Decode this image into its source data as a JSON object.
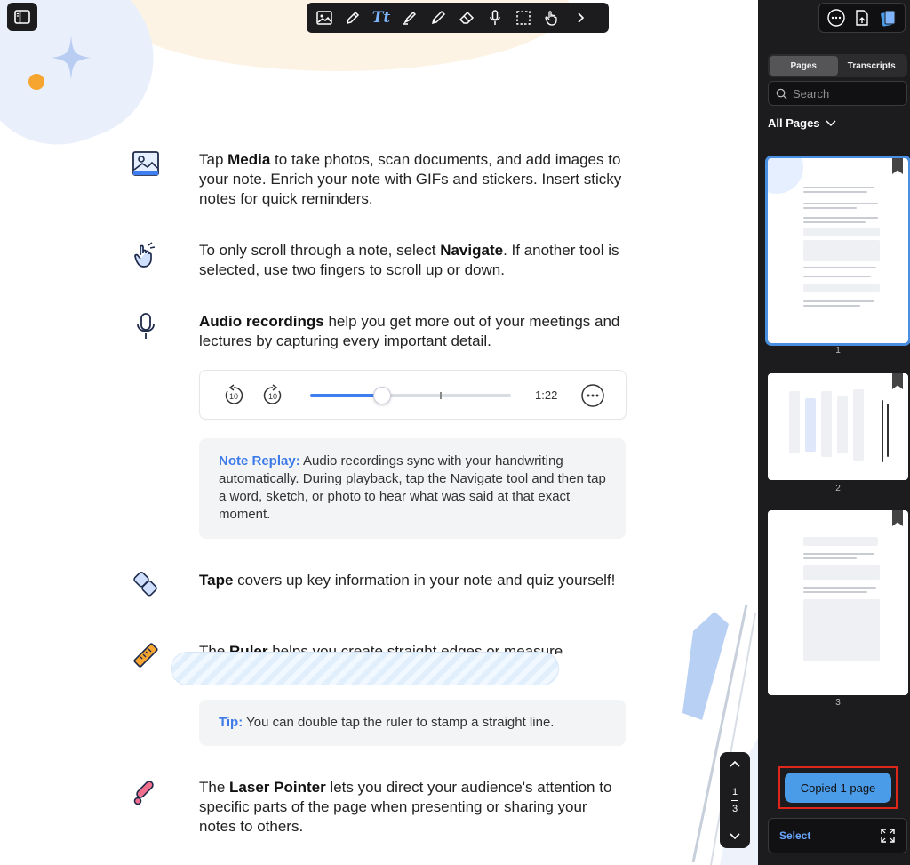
{
  "toolbar": {
    "tools": [
      "media",
      "pen",
      "text",
      "highlighter",
      "pencil",
      "eraser",
      "audio",
      "lasso",
      "navigate"
    ],
    "text_tool_glyph": "Tt",
    "active_color": "#7fb4ff"
  },
  "note": {
    "media": {
      "pre": "Tap ",
      "bold": "Media",
      "post": " to take photos, scan documents, and add images to your note. Enrich your note with GIFs and stickers. Insert sticky notes for quick reminders."
    },
    "navigate": {
      "pre": "To only scroll through a note, select ",
      "bold": "Navigate",
      "post": ". If another tool is selected, use two fingers to scroll up or down."
    },
    "audio": {
      "bold": "Audio recordings",
      "post": " help you get more out of your meetings and lectures by capturing every important detail."
    },
    "player": {
      "time": "1:22",
      "skip_back": "10",
      "skip_forward": "10",
      "progress": 0.36
    },
    "replay_callout": {
      "label": "Note Replay:",
      "text": " Audio recordings sync with your handwriting automatically. During playback, tap the Navigate tool and then tap a word, sketch, or photo to hear what was said at that exact moment."
    },
    "tape": {
      "bold": "Tape",
      "post": " covers up key information in your note and quiz yourself!"
    },
    "ruler": {
      "pre": "The ",
      "bold": "Ruler",
      "post": " helps you create straight edges or measure"
    },
    "tip_callout": {
      "label": "Tip:",
      "text": " You can double tap the ruler to stamp a straight line."
    },
    "laser": {
      "pre": "The ",
      "bold": "Laser Pointer",
      "post": " lets you direct your audience's attention to specific parts of the page when presenting or sharing your notes to others."
    }
  },
  "page_nav": {
    "current": "1",
    "total": "3"
  },
  "panel": {
    "tabs": [
      {
        "label": "Pages",
        "active": true
      },
      {
        "label": "Transcripts",
        "active": false
      }
    ],
    "search_placeholder": "Search",
    "filter_label": "All Pages",
    "pages": [
      {
        "number": "1",
        "selected": true
      },
      {
        "number": "2",
        "selected": false
      },
      {
        "number": "3",
        "selected": false
      }
    ],
    "copied_label": "Copied 1 page",
    "select_label": "Select"
  }
}
